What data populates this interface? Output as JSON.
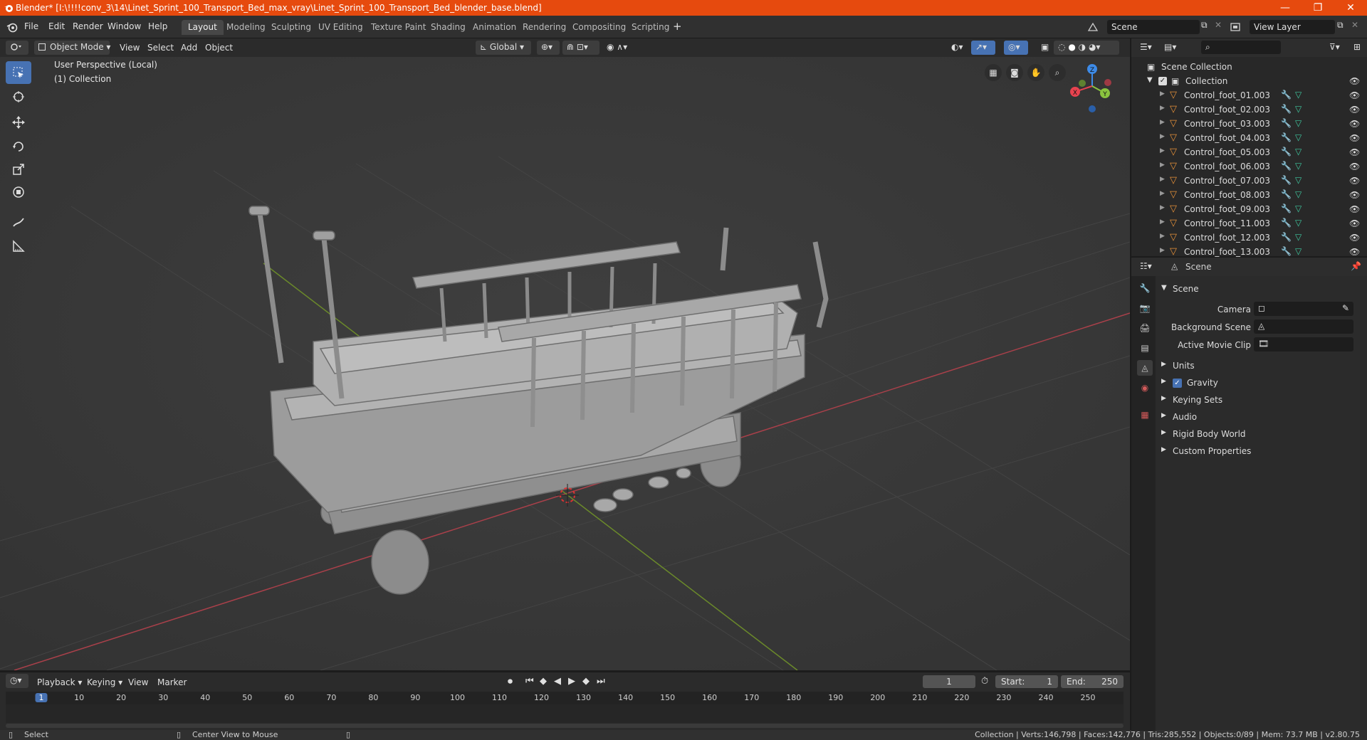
{
  "window": {
    "title": "Blender* [I:\\!!!!conv_3\\14\\Linet_Sprint_100_Transport_Bed_max_vray\\Linet_Sprint_100_Transport_Bed_blender_base.blend]",
    "minimize": "—",
    "maximize": "❐",
    "close": "✕"
  },
  "menu": [
    "File",
    "Edit",
    "Render",
    "Window",
    "Help"
  ],
  "workspaces": [
    "Layout",
    "Modeling",
    "Sculpting",
    "UV Editing",
    "Texture Paint",
    "Shading",
    "Animation",
    "Rendering",
    "Compositing",
    "Scripting"
  ],
  "active_workspace": "Layout",
  "add_workspace": "+",
  "scene_field": "Scene",
  "view_layer_field": "View Layer",
  "viewport_header": {
    "mode": "Object Mode",
    "menus": [
      "View",
      "Select",
      "Add",
      "Object"
    ],
    "orientation": "Global"
  },
  "viewport": {
    "perspective": "User Perspective (Local)",
    "collection": "(1) Collection",
    "gizmo": {
      "x": "X",
      "y": "Y",
      "z": "Z"
    }
  },
  "outliner": {
    "root": "Scene Collection",
    "collection": "Collection",
    "items": [
      "Control_foot_01.003",
      "Control_foot_02.003",
      "Control_foot_03.003",
      "Control_foot_04.003",
      "Control_foot_05.003",
      "Control_foot_06.003",
      "Control_foot_07.003",
      "Control_foot_08.003",
      "Control_foot_09.003",
      "Control_foot_11.003",
      "Control_foot_12.003",
      "Control_foot_13.003"
    ]
  },
  "properties": {
    "context": "Scene",
    "panel": "Scene",
    "camera_label": "Camera",
    "background_scene_label": "Background Scene",
    "active_movie_clip_label": "Active Movie Clip",
    "sections": [
      "Units",
      "Gravity",
      "Keying Sets",
      "Audio",
      "Rigid Body World",
      "Custom Properties"
    ],
    "gravity_checked": true
  },
  "timeline": {
    "menus": [
      "Playback",
      "Keying",
      "View",
      "Marker"
    ],
    "current_frame": "1",
    "start_label": "Start:",
    "start": "1",
    "end_label": "End:",
    "end": "250",
    "ruler": [
      "1",
      "10",
      "20",
      "30",
      "40",
      "50",
      "60",
      "70",
      "80",
      "90",
      "100",
      "110",
      "120",
      "130",
      "140",
      "150",
      "160",
      "170",
      "180",
      "190",
      "200",
      "210",
      "220",
      "230",
      "240",
      "250"
    ]
  },
  "status": {
    "select": "Select",
    "center_view": "Center View to Mouse",
    "stats": "Collection | Verts:146,798 | Faces:142,776 | Tris:285,552 | Objects:0/89 | Mem: 73.7 MB | v2.80.75"
  },
  "colors": {
    "title_bar": "#e64a0e",
    "accent": "#4772b3",
    "x_axis": "#e8434f",
    "y_axis": "#8ac33f",
    "z_axis": "#3d8be8",
    "mesh": "#9a9a9a"
  }
}
